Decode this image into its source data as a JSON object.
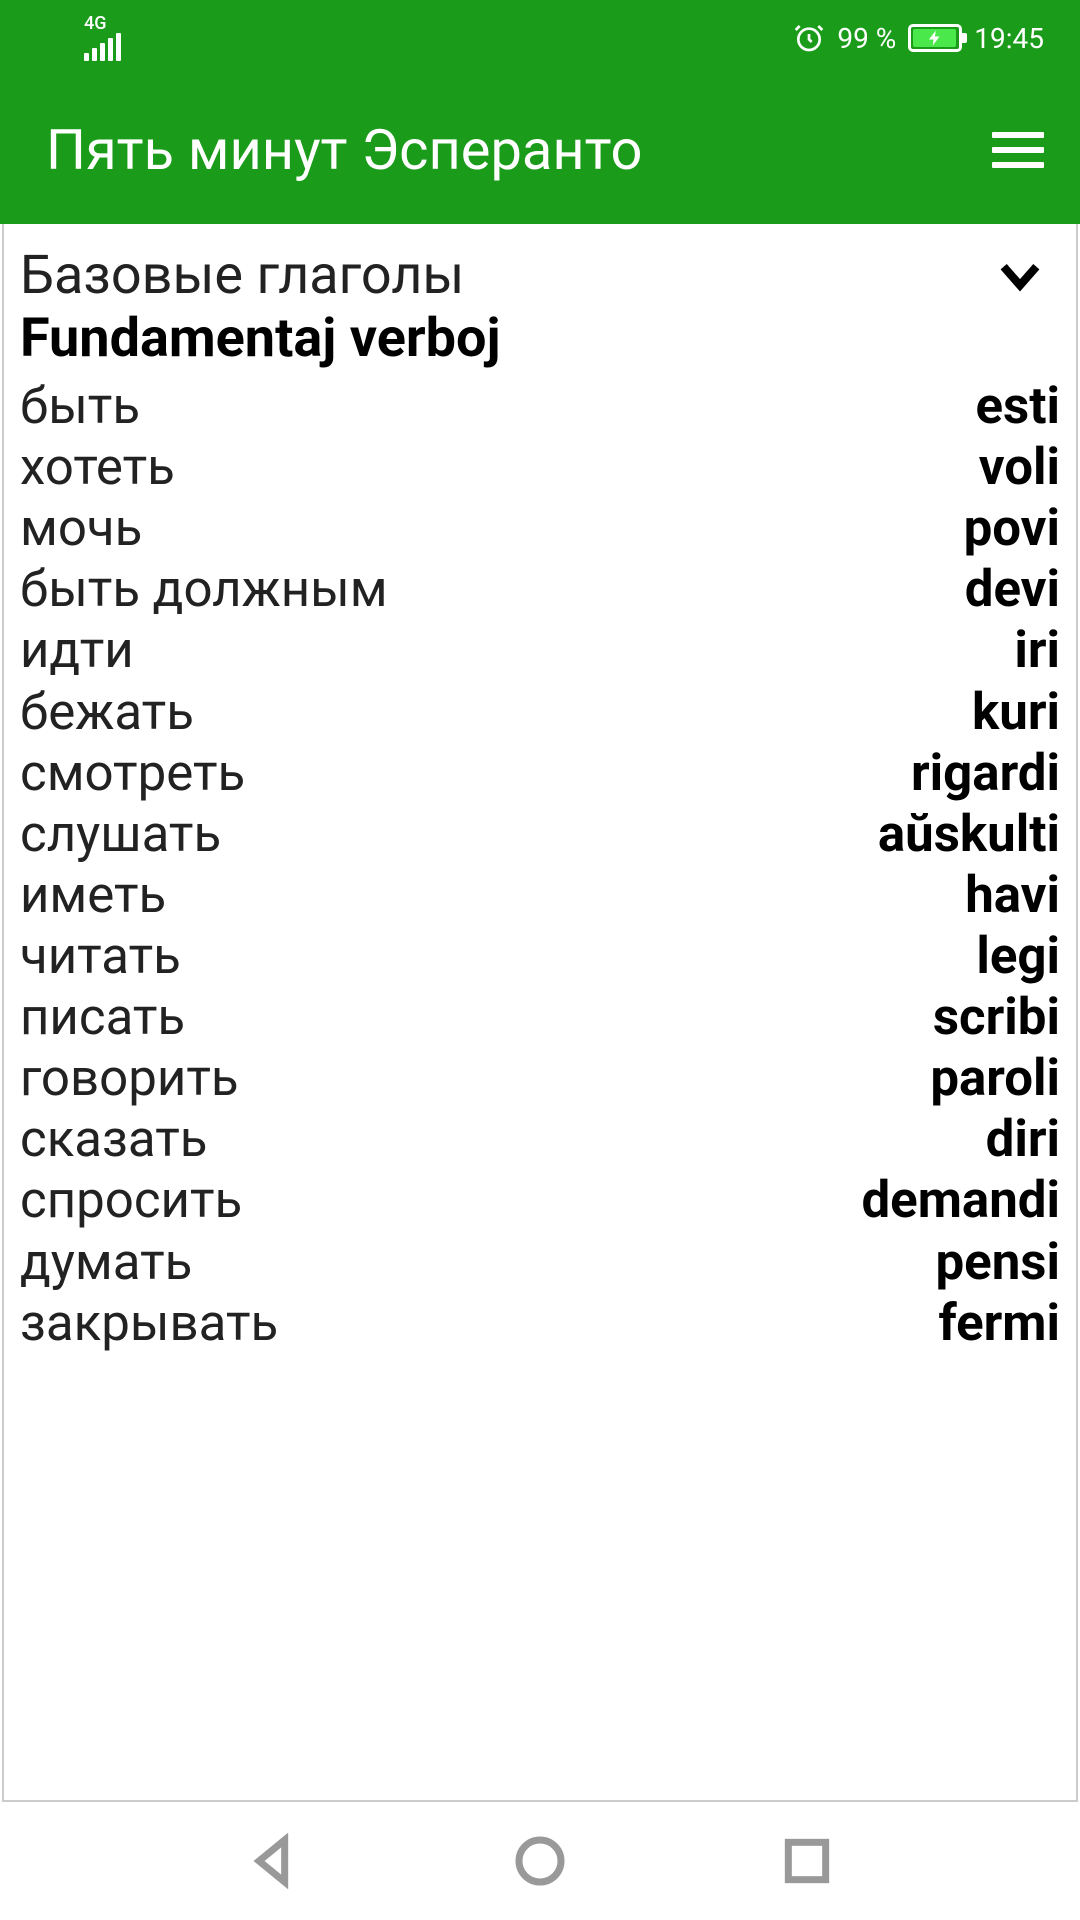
{
  "status": {
    "network": "4G",
    "battery_text": "99 %",
    "time": "19:45"
  },
  "app": {
    "title": "Пять минут Эсперанто"
  },
  "section": {
    "title_ru": "Базовые глаголы",
    "title_eo": "Fundamentaj verboj"
  },
  "vocab": [
    {
      "ru": "быть",
      "eo": "esti"
    },
    {
      "ru": "хотеть",
      "eo": "voli"
    },
    {
      "ru": "мочь",
      "eo": "povi"
    },
    {
      "ru": "быть должным",
      "eo": "devi"
    },
    {
      "ru": "идти",
      "eo": "iri"
    },
    {
      "ru": "бежать",
      "eo": "kuri"
    },
    {
      "ru": "смотреть",
      "eo": "rigardi"
    },
    {
      "ru": "слушать",
      "eo": "aŭskulti"
    },
    {
      "ru": "иметь",
      "eo": "havi"
    },
    {
      "ru": "читать",
      "eo": "legi"
    },
    {
      "ru": "писать",
      "eo": "scribi"
    },
    {
      "ru": "говорить",
      "eo": "paroli"
    },
    {
      "ru": "сказать",
      "eo": "diri"
    },
    {
      "ru": "спросить",
      "eo": "demandi"
    },
    {
      "ru": "думать",
      "eo": "pensi"
    },
    {
      "ru": "закрывать",
      "eo": "fermi"
    }
  ]
}
